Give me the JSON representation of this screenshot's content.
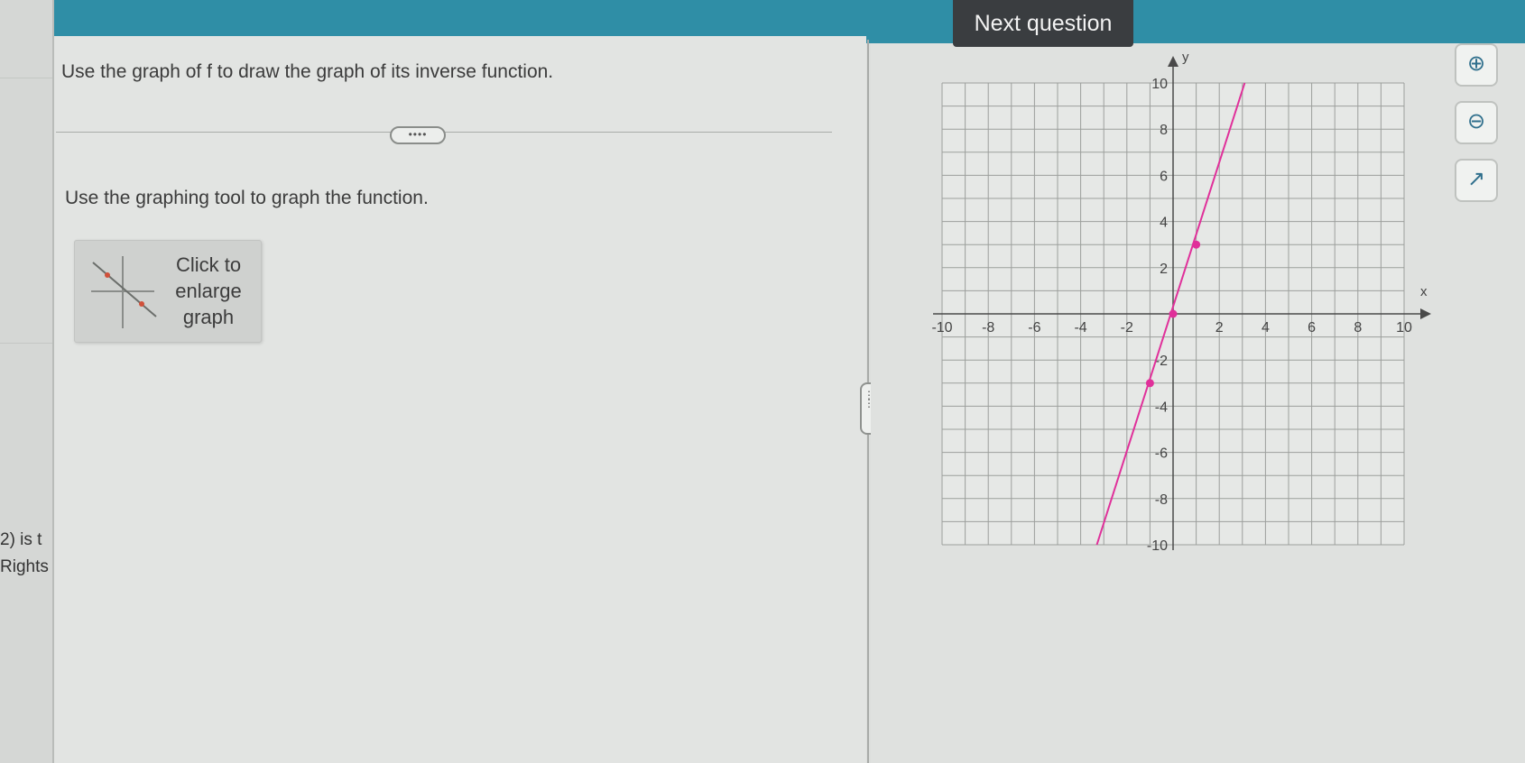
{
  "header": {
    "next_question_label": "Next question"
  },
  "left_edge": {
    "fragment_1": "2) is t",
    "fragment_2": "Rights"
  },
  "question": {
    "instruction": "Use the graph of f to draw the graph of its inverse function.",
    "more_label": "••••",
    "sub_instruction": "Use the graphing tool to graph the function.",
    "thumbnail_label_lines": [
      "Click to",
      "enlarge",
      "graph"
    ]
  },
  "splitter": {
    "handle_label": "⋮"
  },
  "tools": {
    "zoom_in_icon": "zoom-in-icon",
    "zoom_out_icon": "zoom-out-icon",
    "popout_icon": "popout-icon",
    "zoom_in_glyph": "⊕",
    "zoom_out_glyph": "⊖",
    "popout_glyph": "↗"
  },
  "chart_data": {
    "type": "line",
    "xlabel": "x",
    "ylabel": "y",
    "xlim": [
      -10,
      10
    ],
    "ylim": [
      -10,
      10
    ],
    "grid": true,
    "x_ticks": [
      "-10",
      "-8",
      "-6",
      "-4",
      "-2",
      "2",
      "4",
      "6",
      "8",
      "10"
    ],
    "y_ticks": [
      "10",
      "8",
      "6",
      "4",
      "2",
      "-2",
      "-4",
      "-6",
      "-8",
      "-10"
    ],
    "series": [
      {
        "color": "#e0309a",
        "x": [
          -3.3,
          3.1
        ],
        "y": [
          -10,
          10
        ],
        "points": [
          {
            "x": -1,
            "y": -3
          },
          {
            "x": 0,
            "y": 0
          },
          {
            "x": 1,
            "y": 3
          }
        ]
      }
    ],
    "colors": {
      "grid": "#9c9f9c",
      "axis": "#4a4a4a",
      "line": "#e0309a"
    }
  }
}
